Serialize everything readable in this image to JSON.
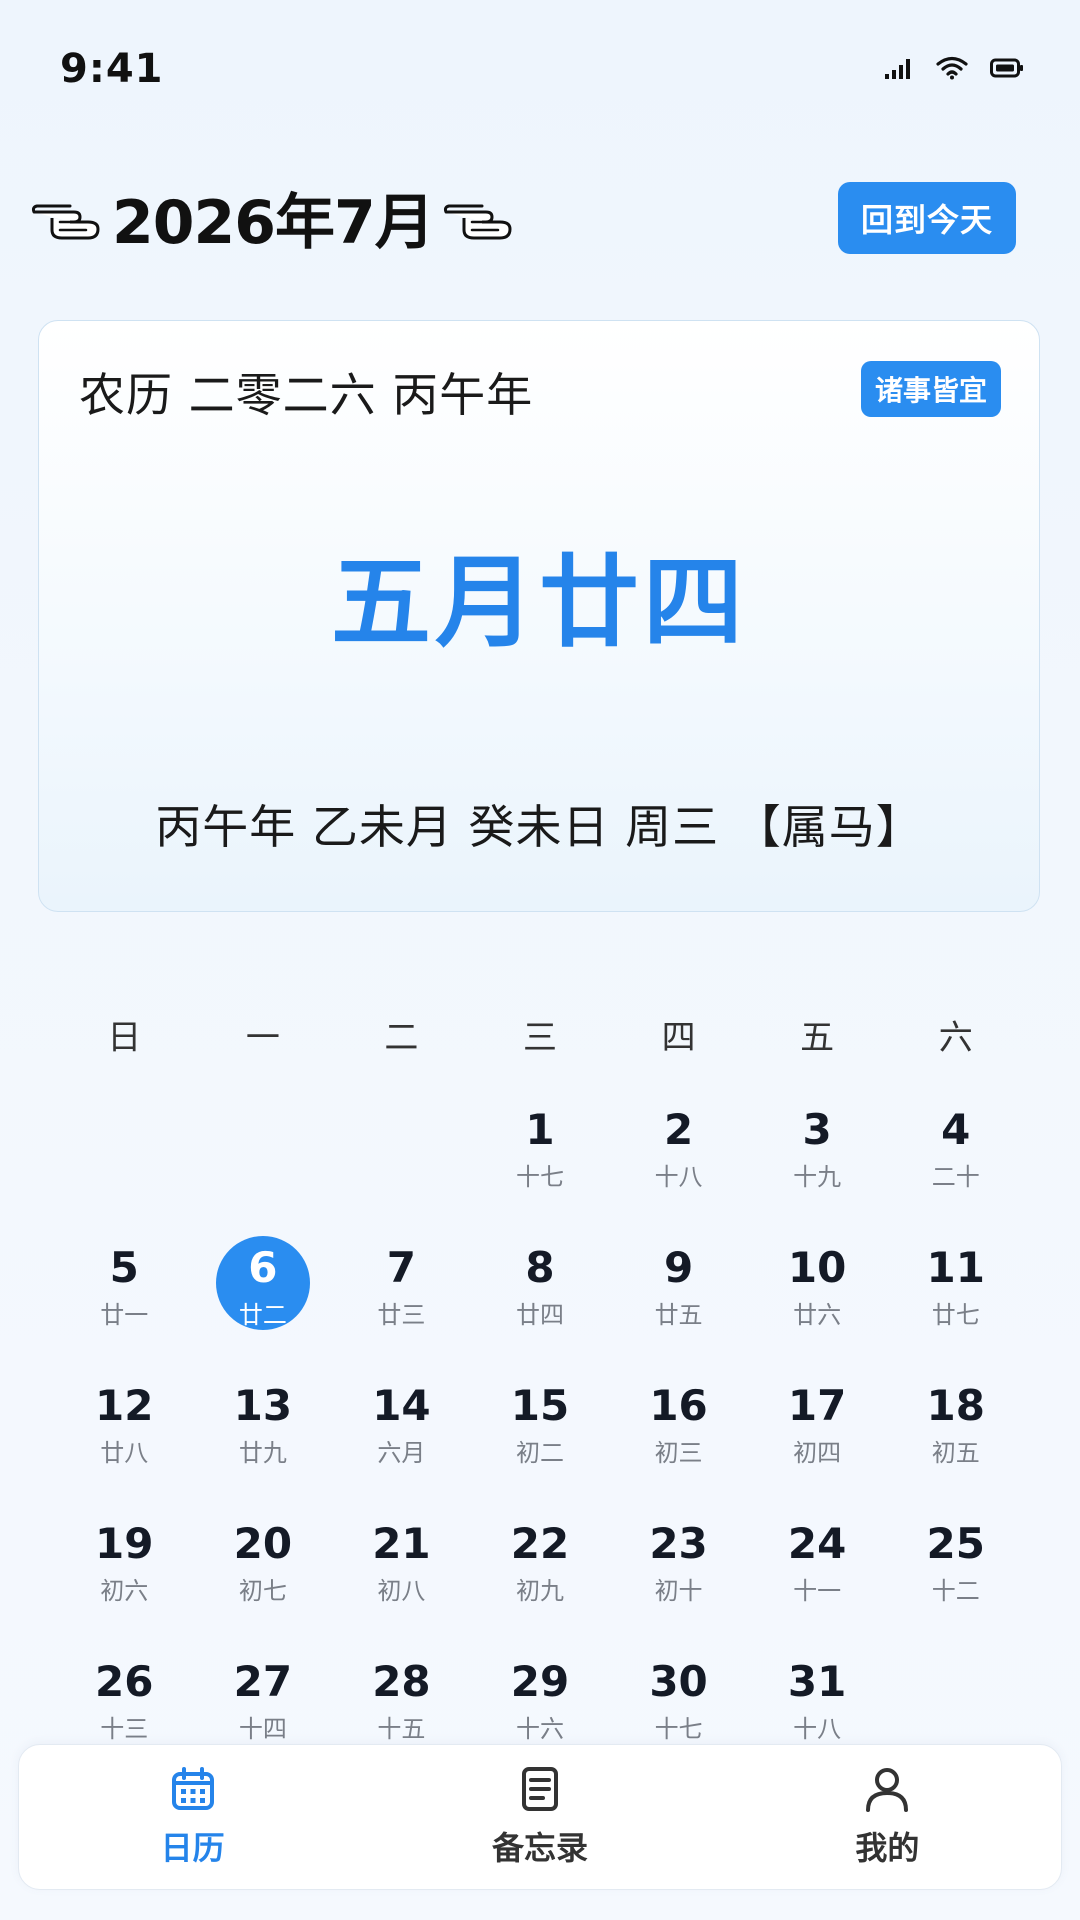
{
  "status_bar": {
    "time": "9:41"
  },
  "header": {
    "month_title": "2026年7月",
    "today_button": "回到今天"
  },
  "lunar_card": {
    "year_text": "农历 二零二六 丙午年",
    "badge": "诸事皆宜",
    "lunar_date": "五月廿四",
    "ganzhi": "丙午年 乙未月 癸未日 周三 【属马】"
  },
  "weekdays": [
    "日",
    "一",
    "二",
    "三",
    "四",
    "五",
    "六"
  ],
  "days": [
    {
      "day": "",
      "lunar": ""
    },
    {
      "day": "",
      "lunar": ""
    },
    {
      "day": "",
      "lunar": ""
    },
    {
      "day": "1",
      "lunar": "十七"
    },
    {
      "day": "2",
      "lunar": "十八"
    },
    {
      "day": "3",
      "lunar": "十九"
    },
    {
      "day": "4",
      "lunar": "二十"
    },
    {
      "day": "5",
      "lunar": "廿一"
    },
    {
      "day": "6",
      "lunar": "廿二",
      "selected": true
    },
    {
      "day": "7",
      "lunar": "廿三"
    },
    {
      "day": "8",
      "lunar": "廿四"
    },
    {
      "day": "9",
      "lunar": "廿五"
    },
    {
      "day": "10",
      "lunar": "廿六"
    },
    {
      "day": "11",
      "lunar": "廿七"
    },
    {
      "day": "12",
      "lunar": "廿八"
    },
    {
      "day": "13",
      "lunar": "廿九"
    },
    {
      "day": "14",
      "lunar": "六月"
    },
    {
      "day": "15",
      "lunar": "初二"
    },
    {
      "day": "16",
      "lunar": "初三"
    },
    {
      "day": "17",
      "lunar": "初四"
    },
    {
      "day": "18",
      "lunar": "初五"
    },
    {
      "day": "19",
      "lunar": "初六"
    },
    {
      "day": "20",
      "lunar": "初七"
    },
    {
      "day": "21",
      "lunar": "初八"
    },
    {
      "day": "22",
      "lunar": "初九"
    },
    {
      "day": "23",
      "lunar": "初十"
    },
    {
      "day": "24",
      "lunar": "十一"
    },
    {
      "day": "25",
      "lunar": "十二"
    },
    {
      "day": "26",
      "lunar": "十三"
    },
    {
      "day": "27",
      "lunar": "十四"
    },
    {
      "day": "28",
      "lunar": "十五"
    },
    {
      "day": "29",
      "lunar": "十六"
    },
    {
      "day": "30",
      "lunar": "十七"
    },
    {
      "day": "31",
      "lunar": "十八"
    }
  ],
  "tabs": [
    {
      "label": "日历",
      "icon": "calendar-icon",
      "active": true
    },
    {
      "label": "备忘录",
      "icon": "memo-icon",
      "active": false
    },
    {
      "label": "我的",
      "icon": "user-icon",
      "active": false
    }
  ],
  "colors": {
    "accent": "#2a8df0",
    "lunar_date": "#2584ea",
    "text": "#141a26",
    "muted": "#7a7f88"
  }
}
